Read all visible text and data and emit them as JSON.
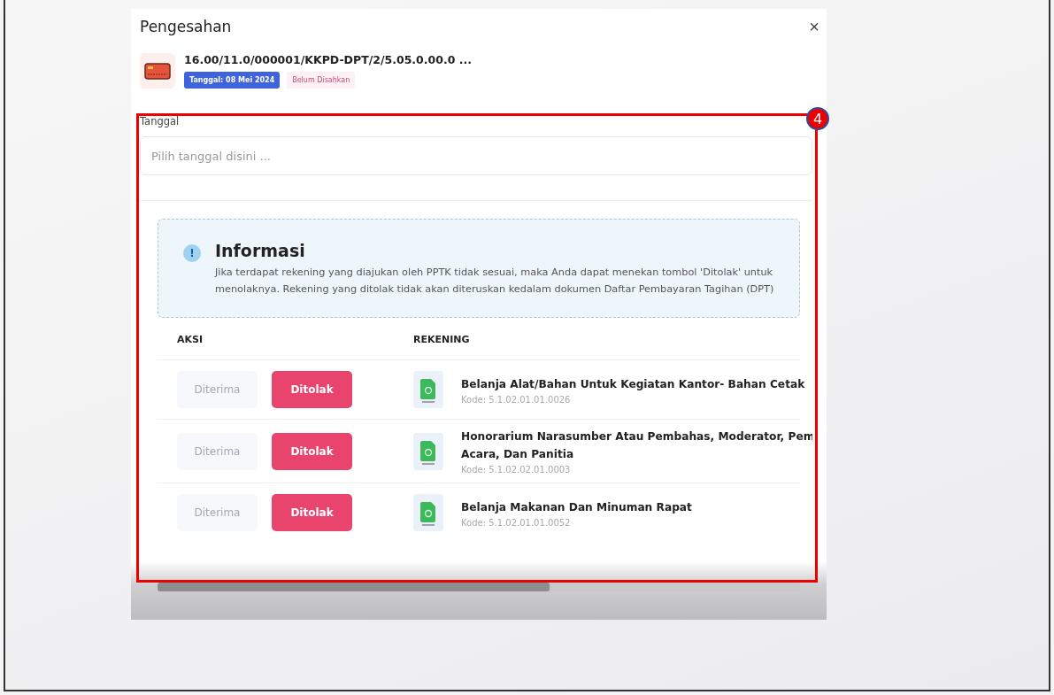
{
  "dialog": {
    "title": "Pengesahan",
    "close": "×"
  },
  "document": {
    "code": "16.00/11.0/000001/KKPD-DPT/2/5.05.0.00.0 ...",
    "date_badge": "Tanggal: 08 Mei 2024",
    "status_badge": "Belum Disahkan"
  },
  "date_field": {
    "label": "Tanggal",
    "placeholder": "Pilih tanggal disini ..."
  },
  "info": {
    "icon": "!",
    "title": "Informasi",
    "text": "Jika terdapat rekening yang diajukan oleh PPTK tidak sesuai, maka Anda dapat menekan tombol 'Ditolak' untuk menolaknya. Rekening yang ditolak tidak akan diteruskan kedalam dokumen Daftar Pembayaran Tagihan (DPT)"
  },
  "table": {
    "columns": [
      "AKSI",
      "REKENING"
    ],
    "rows": [
      {
        "actions": [
          {
            "label": "Diterima",
            "selected": false
          },
          {
            "label": "Ditolak",
            "selected": true
          }
        ],
        "name_lines": [
          "Belanja Alat/Bahan Untuk Kegiatan Kantor- Bahan Cetak"
        ],
        "code": "Kode: 5.1.02.01.01.0026"
      },
      {
        "actions": [
          {
            "label": "Diterima",
            "selected": false
          },
          {
            "label": "Ditolak",
            "selected": true
          }
        ],
        "name_lines": [
          "Honorarium Narasumber Atau Pembahas, Moderator, Pem",
          "Acara, Dan Panitia"
        ],
        "code": "Kode: 5.1.02.02.01.0003"
      },
      {
        "actions": [
          {
            "label": "Diterima",
            "selected": false
          },
          {
            "label": "Ditolak",
            "selected": true
          }
        ],
        "name_lines": [
          "Belanja Makanan Dan Minuman Rapat"
        ],
        "code": "Kode: 5.1.02.01.01.0052"
      }
    ]
  },
  "highlight": {
    "badge": "4"
  }
}
